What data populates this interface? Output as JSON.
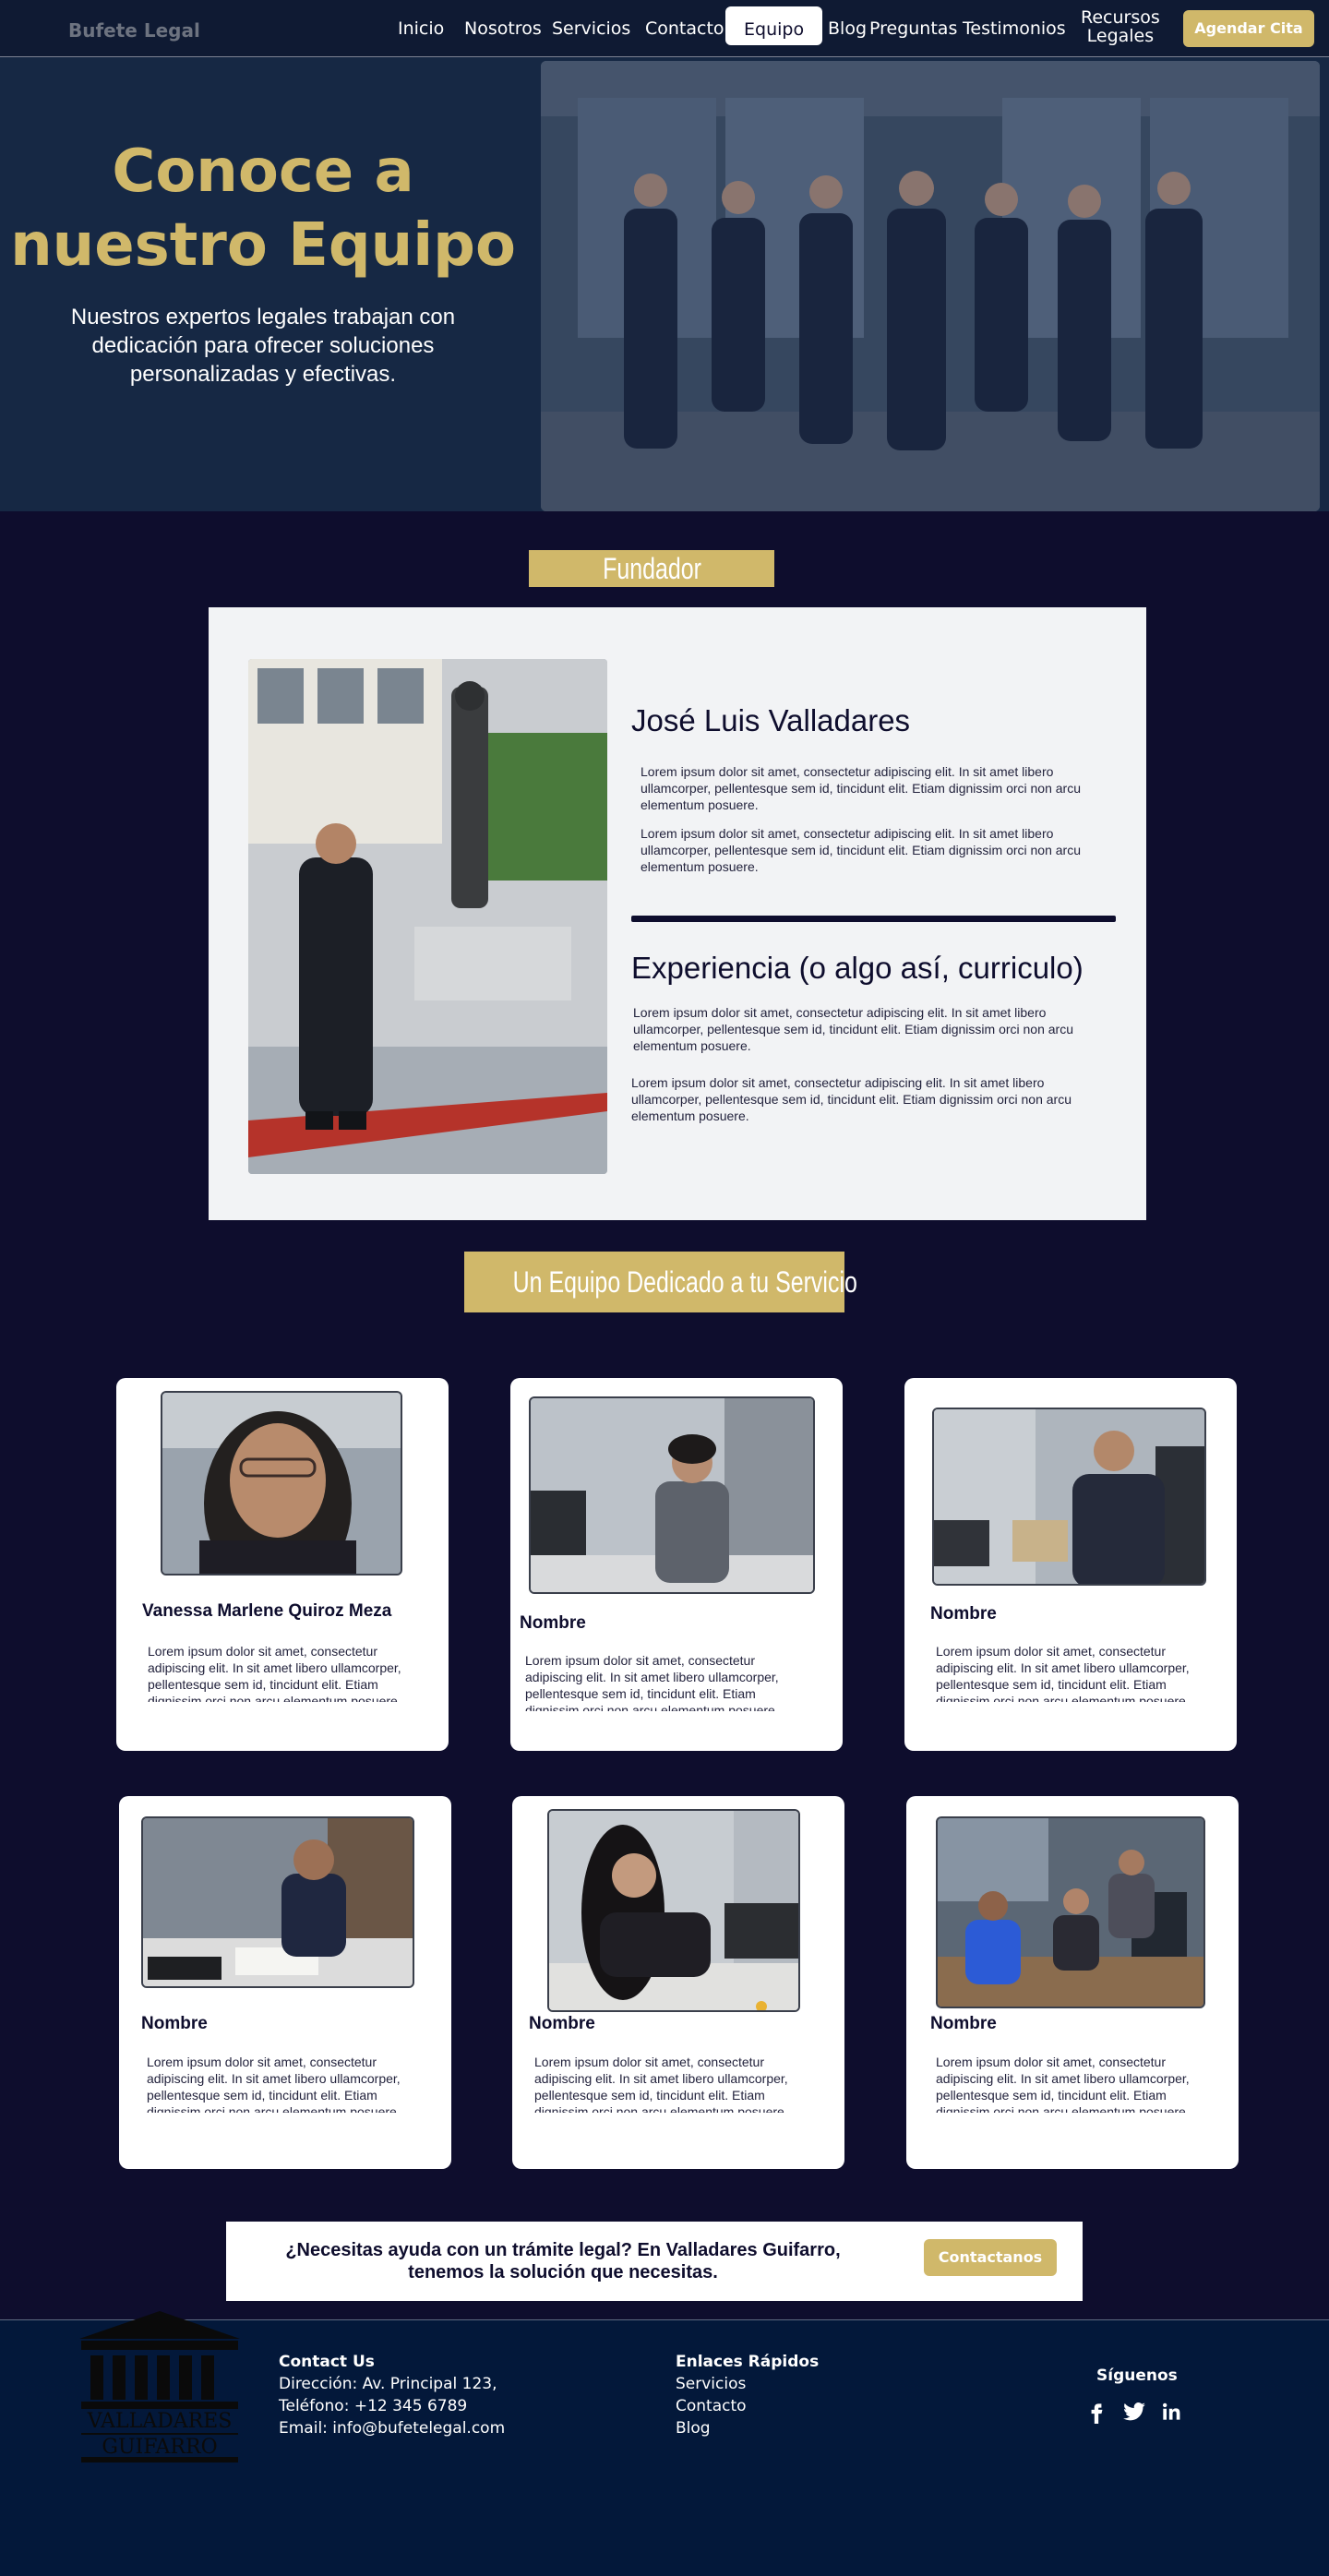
{
  "nav": {
    "brand": "Bufete Legal",
    "links": [
      "Inicio",
      "Nosotros",
      "Servicios",
      "Contacto",
      "Equipo",
      "Blog",
      "Preguntas",
      "Testimonios"
    ],
    "recursos_line1": "Recursos",
    "recursos_line2": "Legales",
    "cta": "Agendar Cita"
  },
  "hero": {
    "title_line1": "Conoce a",
    "title_line2": "nuestro Equipo",
    "subtitle": "Nuestros expertos legales trabajan con dedicación para ofrecer soluciones personalizadas y efectivas."
  },
  "founder": {
    "section_title": "Fundador",
    "name": "José Luis Valladares",
    "paragraphs": [
      "Lorem ipsum dolor sit amet, consectetur adipiscing elit. In sit amet libero ullamcorper, pellentesque sem id, tincidunt elit. Etiam dignissim orci non arcu elementum posuere.",
      "Lorem ipsum dolor sit amet, consectetur adipiscing elit. In sit amet libero ullamcorper, pellentesque sem id, tincidunt elit. Etiam dignissim orci non arcu elementum posuere."
    ],
    "experience_title": "Experiencia (o algo así, curriculo)",
    "experience_paragraphs": [
      "Lorem ipsum dolor sit amet, consectetur adipiscing elit. In sit amet libero ullamcorper, pellentesque sem id, tincidunt elit. Etiam dignissim orci non arcu elementum posuere.",
      "Lorem ipsum dolor sit amet, consectetur adipiscing elit. In sit amet libero ullamcorper, pellentesque sem id, tincidunt elit. Etiam dignissim orci non arcu elementum posuere."
    ]
  },
  "team": {
    "section_title": "Un Equipo Dedicado a tu Servicio",
    "members": [
      {
        "name": "Vanessa Marlene Quiroz Meza",
        "text": "Lorem ipsum dolor sit amet, consectetur adipiscing elit. In sit amet libero ullamcorper, pellentesque sem id, tincidunt elit. Etiam dignissim orci non arcu elementum posuere."
      },
      {
        "name": "Nombre",
        "text": "Lorem ipsum dolor sit amet, consectetur adipiscing elit. In sit amet libero ullamcorper, pellentesque sem id, tincidunt elit. Etiam dignissim orci non arcu elementum posuere."
      },
      {
        "name": "Nombre",
        "text": "Lorem ipsum dolor sit amet, consectetur adipiscing elit. In sit amet libero ullamcorper, pellentesque sem id, tincidunt elit. Etiam dignissim orci non arcu elementum posuere."
      },
      {
        "name": "Nombre",
        "text": "Lorem ipsum dolor sit amet, consectetur adipiscing elit. In sit amet libero ullamcorper, pellentesque sem id, tincidunt elit. Etiam dignissim orci non arcu elementum posuere."
      },
      {
        "name": "Nombre",
        "text": "Lorem ipsum dolor sit amet, consectetur adipiscing elit. In sit amet libero ullamcorper, pellentesque sem id, tincidunt elit. Etiam dignissim orci non arcu elementum posuere."
      },
      {
        "name": "Nombre",
        "text": "Lorem ipsum dolor sit amet, consectetur adipiscing elit. In sit amet libero ullamcorper, pellentesque sem id, tincidunt elit. Etiam dignissim orci non arcu elementum posuere."
      }
    ]
  },
  "cta": {
    "text": "¿Necesitas ayuda con un trámite legal? En Valladares Guifarro, tenemos la solución que necesitas.",
    "button": "Contactanos"
  },
  "footer": {
    "logo_line1": "VALLADARES",
    "logo_line2": "GUIFARRO",
    "contact_heading": "Contact Us",
    "address": "Dirección: Av. Principal 123,",
    "phone": "Teléfono: +12 345 6789",
    "email": "Email: info@bufetelegal.com",
    "links_heading": "Enlaces Rápidos",
    "links": [
      "Servicios",
      "Contacto",
      "Blog"
    ],
    "social_heading": "Síguenos",
    "social_icons": [
      "facebook-icon",
      "twitter-icon",
      "linkedin-icon"
    ]
  },
  "colors": {
    "navy": "#0e0d2d",
    "gold": "#d0b86a",
    "hero_bg": "#162844",
    "footer_bg": "#03183a"
  }
}
